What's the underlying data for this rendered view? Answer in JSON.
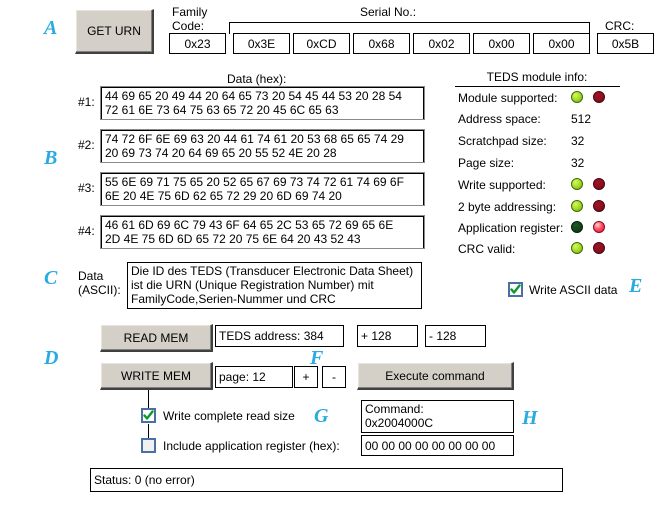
{
  "annotations": {
    "a": "A",
    "b": "B",
    "c": "C",
    "d": "D",
    "e": "E",
    "f": "F",
    "g": "G",
    "h": "H"
  },
  "header": {
    "get_urn_button": "GET URN",
    "family_code_label": "Family\nCode:",
    "serial_no_label": "Serial No.:",
    "crc_label": "CRC:",
    "family_code_value": "0x23",
    "serial_values": [
      "0x3E",
      "0xCD",
      "0x68",
      "0x02",
      "0x00",
      "0x00"
    ],
    "crc_value": "0x5B"
  },
  "data_hex": {
    "title": "Data (hex):",
    "rows": [
      {
        "label": "#1:",
        "value": "44 69 65 20 49 44 20 64 65 73 20 54 45 44 53 20 28 54\n72 61 6E 73 64 75 63 65 72 20 45 6C 65 63"
      },
      {
        "label": "#2:",
        "value": "74 72 6F 6E 69 63 20 44 61 74 61 20 53 68 65 65 74 29\n20 69 73 74 20 64 69 65 20 55 52 4E 20 28"
      },
      {
        "label": "#3:",
        "value": "55 6E 69 71 75 65 20 52 65 67 69 73 74 72 61 74 69 6F\n6E 20 4E 75 6D 62 65 72 29 20 6D 69 74 20"
      },
      {
        "label": "#4:",
        "value": "46 61 6D 69 6C 79 43 6F 64 65 2C 53 65 72 69 65 6E\n2D 4E 75 6D 6D 65 72 20 75 6E 64 20 43 52 43"
      }
    ]
  },
  "teds_info": {
    "title": "TEDS module info:",
    "rows": [
      {
        "label": "Module supported:",
        "type": "led",
        "green": "on",
        "red": "off"
      },
      {
        "label": "Address space:",
        "type": "value",
        "value": "512"
      },
      {
        "label": "Scratchpad size:",
        "type": "value",
        "value": "32"
      },
      {
        "label": "Page size:",
        "type": "value",
        "value": "32"
      },
      {
        "label": "Write supported:",
        "type": "led",
        "green": "on",
        "red": "off"
      },
      {
        "label": "2 byte addressing:",
        "type": "led",
        "green": "on",
        "red": "off"
      },
      {
        "label": "Application register:",
        "type": "led",
        "green": "off",
        "red": "on"
      },
      {
        "label": "CRC valid:",
        "type": "led",
        "green": "on",
        "red": "off"
      }
    ]
  },
  "ascii": {
    "label": "Data\n(ASCII):",
    "value": "Die ID des TEDS (Transducer Electronic Data Sheet) ist die URN (Unique Registration Number) mit FamilyCode,Serien-Nummer und CRC",
    "write_ascii_checkbox_label": "Write ASCII data",
    "write_ascii_checked": true
  },
  "controls": {
    "read_mem_button": "READ MEM",
    "write_mem_button": "WRITE MEM",
    "teds_address_field": "TEDS address: 384",
    "plus_128_button": "+ 128",
    "minus_128_button": "- 128",
    "page_field": "page: 12",
    "page_plus_button": "+",
    "page_minus_button": "-",
    "execute_command_button": "Execute command",
    "write_complete_label": "Write complete read size",
    "write_complete_checked": true,
    "include_app_register_label": "Include application register (hex):",
    "include_app_register_checked": false,
    "command_field": "Command:\n0x2004000C",
    "app_register_hex_field": "00 00 00 00 00 00 00 00"
  },
  "status": {
    "text": "Status: 0 (no error)"
  },
  "colors": {
    "annotation_blue": "#29ABE2",
    "button_face": "#d4d0c8",
    "led_green_on": "#a8e02a",
    "led_green_off": "#13431a",
    "led_red_on": "#ff4d63",
    "led_red_off": "#8d0f20",
    "checkbox_border": "#4a6fa5",
    "check_green": "#0a9a2a"
  }
}
